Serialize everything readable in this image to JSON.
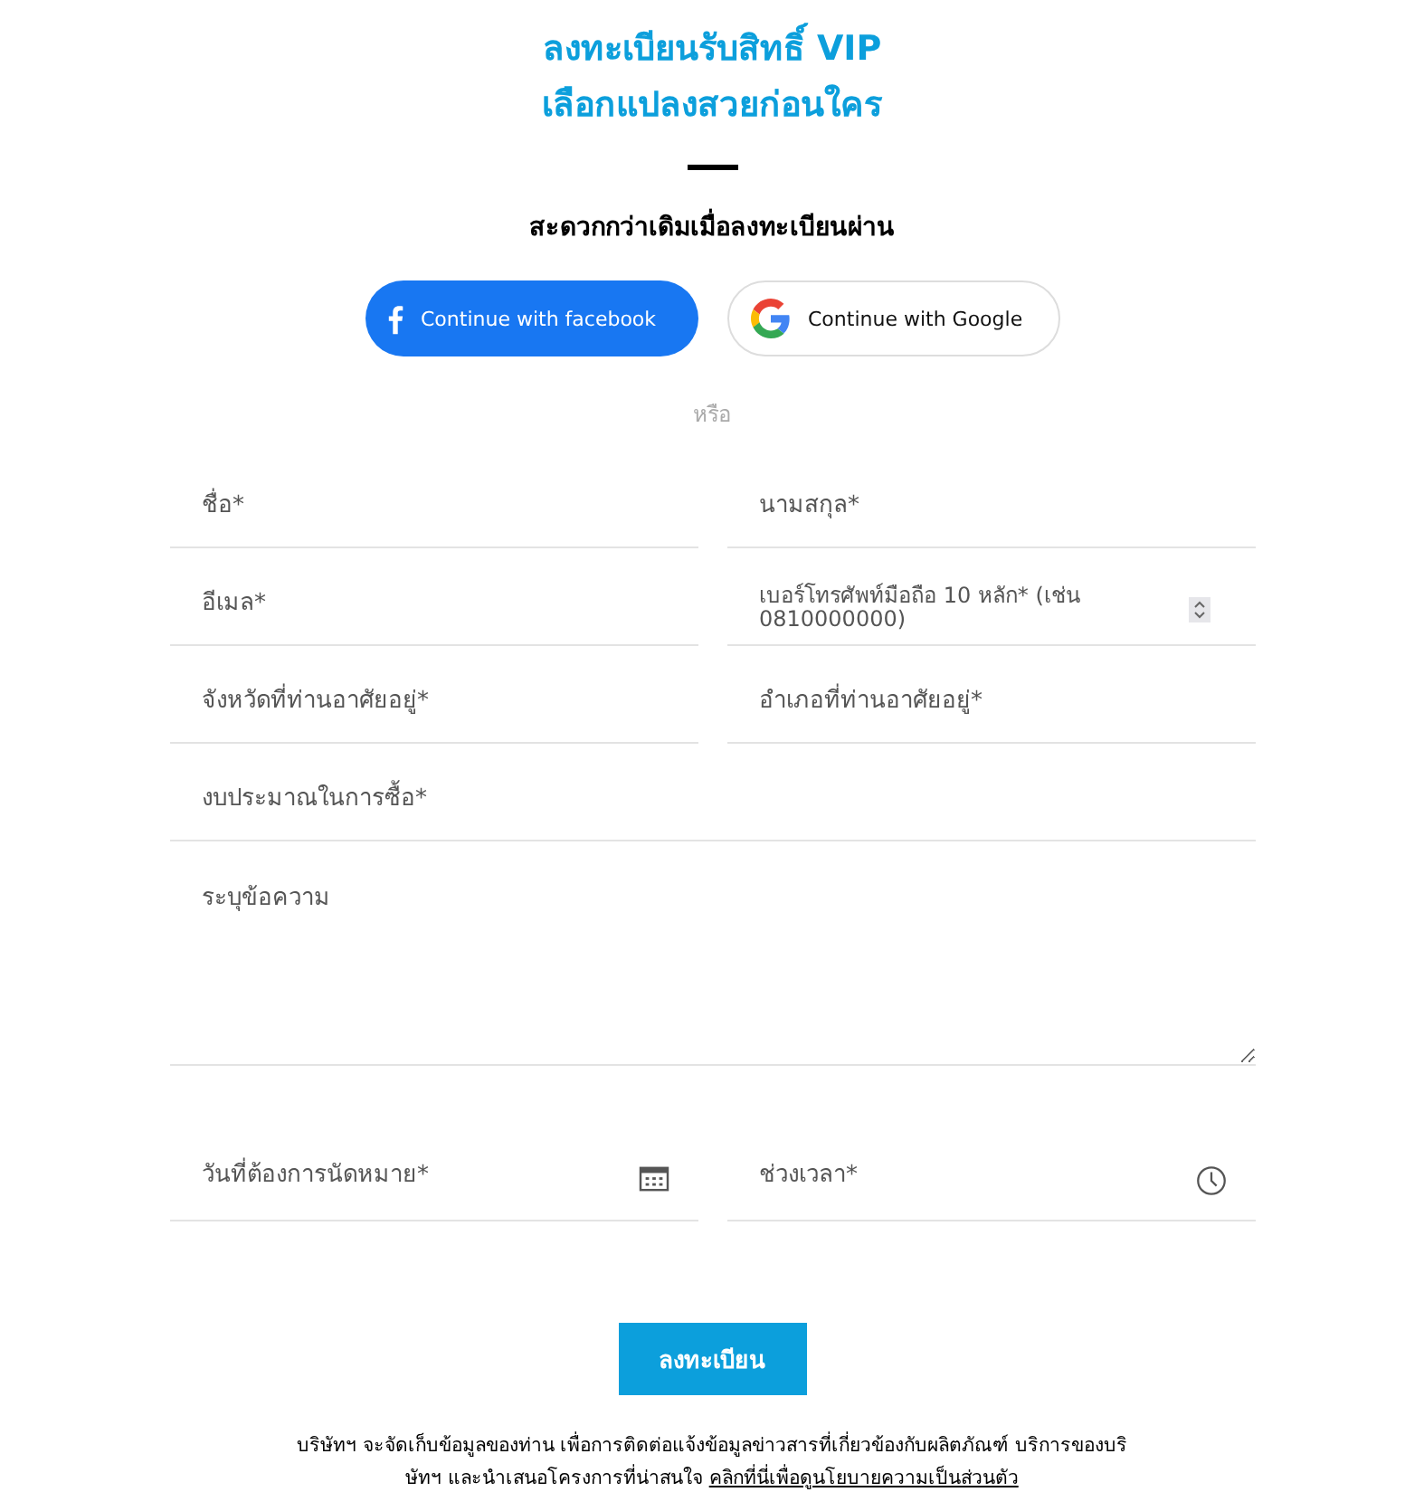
{
  "heading": {
    "lines": [
      "ลงทะเบียนรับสิทธิ์ VIP",
      "เลือกแปลงสวยก่อนใคร"
    ],
    "subtitle": "สะดวกกว่าเดิมเมื่อลงทะเบียนผ่าน"
  },
  "social_buttons": [
    {
      "kind": "facebook",
      "label": "Continue with facebook"
    },
    {
      "kind": "google",
      "label": "Continue with Google"
    }
  ],
  "separator": "หรือ",
  "fields": [
    {
      "kind": "text",
      "placeholder": "ชื่อ*",
      "full_width": false
    },
    {
      "kind": "text",
      "placeholder": "นามสกุล*",
      "full_width": false
    },
    {
      "kind": "text",
      "placeholder": "อีเมล*",
      "full_width": false
    },
    {
      "kind": "number",
      "placeholder": "เบอร์โทรศัพท์มือถือ 10 หลัก* (เช่น 0810000000)",
      "full_width": false
    },
    {
      "kind": "text",
      "placeholder": "จังหวัดที่ท่านอาศัยอยู่*",
      "full_width": false
    },
    {
      "kind": "text",
      "placeholder": "อำเภอที่ท่านอาศัยอยู่*",
      "full_width": false
    },
    {
      "kind": "text",
      "placeholder": "งบประมาณในการซื้อ*",
      "full_width": true
    },
    {
      "kind": "textarea",
      "placeholder": "ระบุข้อความ",
      "full_width": true
    },
    {
      "kind": "date",
      "placeholder": "วันที่ต้องการนัดหมาย*",
      "full_width": false
    },
    {
      "kind": "time",
      "placeholder": "ช่วงเวลา*",
      "full_width": false
    }
  ],
  "submit": "ลงทะเบียน",
  "notice": {
    "text": "บริษัทฯ จะจัดเก็บข้อมูลของท่าน เพื่อการติดต่อแจ้งข้อมูลข่าวสารที่เกี่ยวข้องกับผลิตภัณฑ์ บริการของบริษัทฯ และนำเสนอโครงการที่น่าสนใจ",
    "link": "คลิกที่นี่เพื่อดูนโยบายความเป็นส่วนตัว"
  }
}
